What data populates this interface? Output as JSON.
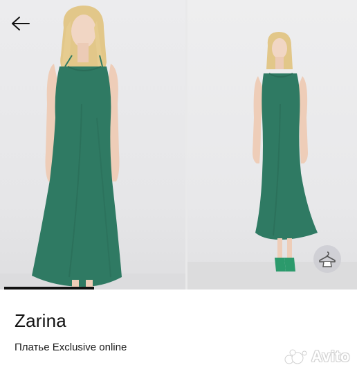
{
  "header": {
    "back_icon": "arrow-left-icon"
  },
  "gallery": {
    "photo_1_alt_icon": "product-photo",
    "photo_2_alt_icon": "product-photo",
    "progress_fraction": 0.5,
    "tryon_icon": "shirt-hanger-icon",
    "colors": {
      "dress": "#2f7a63",
      "sandals": "#2c9a6c"
    }
  },
  "product": {
    "brand": "Zarina",
    "name": "Платье Exclusive online"
  },
  "watermark": {
    "text": "Avito"
  }
}
